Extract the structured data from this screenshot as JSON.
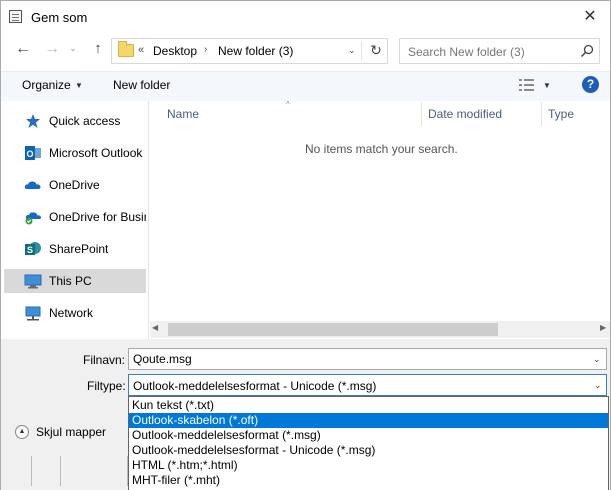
{
  "window": {
    "title": "Gem som",
    "close_glyph": "✕",
    "app_icon": "document-icon"
  },
  "navigation": {
    "back_glyph": "←",
    "forward_glyph": "→",
    "up_glyph": "↑",
    "recent_glyph": "⌄",
    "address": {
      "overflow": "«",
      "crumbs": [
        "Desktop",
        "New folder (3)"
      ],
      "separator": "›",
      "dropdown_glyph": "⌄",
      "refresh_glyph": "↻"
    },
    "search": {
      "placeholder": "Search New folder (3)",
      "icon": "search-icon"
    }
  },
  "toolbar": {
    "organize_label": "Organize",
    "organize_caret": "▼",
    "new_folder_label": "New folder",
    "view_caret": "▼",
    "help_label": "?"
  },
  "sidebar": {
    "items": [
      {
        "label": "Quick access",
        "icon": "star-icon"
      },
      {
        "label": "Microsoft Outlook",
        "icon": "outlook-icon"
      },
      {
        "label": "OneDrive",
        "icon": "cloud-icon"
      },
      {
        "label": "OneDrive for Business",
        "icon": "cloud-check-icon"
      },
      {
        "label": "SharePoint",
        "icon": "sharepoint-icon"
      },
      {
        "label": "This PC",
        "icon": "computer-icon",
        "selected": true
      },
      {
        "label": "Network",
        "icon": "network-icon"
      }
    ]
  },
  "filelist": {
    "sort_glyph": "^",
    "columns": [
      "Name",
      "Date modified",
      "Type"
    ],
    "empty_message": "No items match your search."
  },
  "scrollbar": {
    "left_glyph": "◀",
    "right_glyph": "▶"
  },
  "form": {
    "filename_label": "Filnavn:",
    "filename_value": "Qoute.msg",
    "filetype_label": "Filtype:",
    "filetype_value": "Outlook-meddelelsesformat - Unicode (*.msg)",
    "caret_glyph": "⌄",
    "filetype_options": [
      "Kun tekst (*.txt)",
      "Outlook-skabelon (*.oft)",
      "Outlook-meddelelsesformat (*.msg)",
      "Outlook-meddelelsesformat - Unicode (*.msg)",
      "HTML (*.htm;*.html)",
      "MHT-filer (*.mht)"
    ],
    "highlighted_option": "Outlook-skabelon (*.oft)"
  },
  "footer": {
    "hide_folders_label": "Skjul mapper",
    "hide_folders_glyph": "▲"
  },
  "colors": {
    "accent": "#0078d7",
    "help": "#1e5db8",
    "selection": "#d9d9d9"
  }
}
